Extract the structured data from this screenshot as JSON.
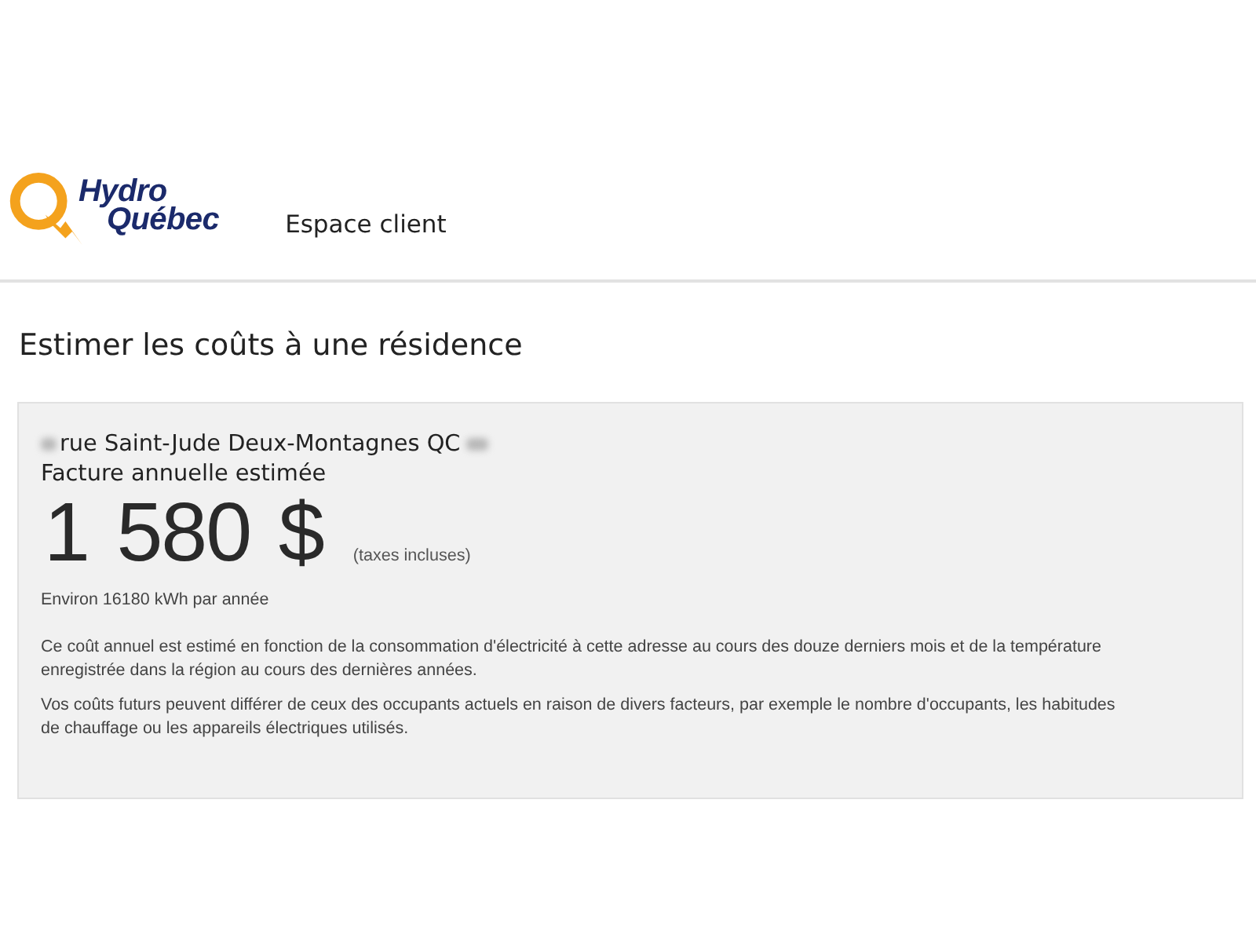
{
  "header": {
    "logo": {
      "lines": [
        "Hydro",
        "Québec"
      ]
    },
    "section": "Espace client"
  },
  "page": {
    "title": "Estimer les coûts à une résidence"
  },
  "estimate": {
    "address": "rue Saint-Jude Deux-Montagnes QC",
    "label": "Facture annuelle estimée",
    "amount": "1 580 $",
    "amount_note": "(taxes incluses)",
    "consumption": "Environ 16180 kWh par année",
    "paragraphs": [
      "Ce coût annuel est estimé en fonction de la consommation d'électricité à cette adresse au cours des douze derniers mois et de la température enregistrée dans la région au cours des dernières années.",
      "Vos coûts futurs peuvent différer de ceux des occupants actuels en raison de divers facteurs, par exemple le nombre d'occupants, les habitudes de chauffage ou les appareils électriques utilisés."
    ]
  }
}
